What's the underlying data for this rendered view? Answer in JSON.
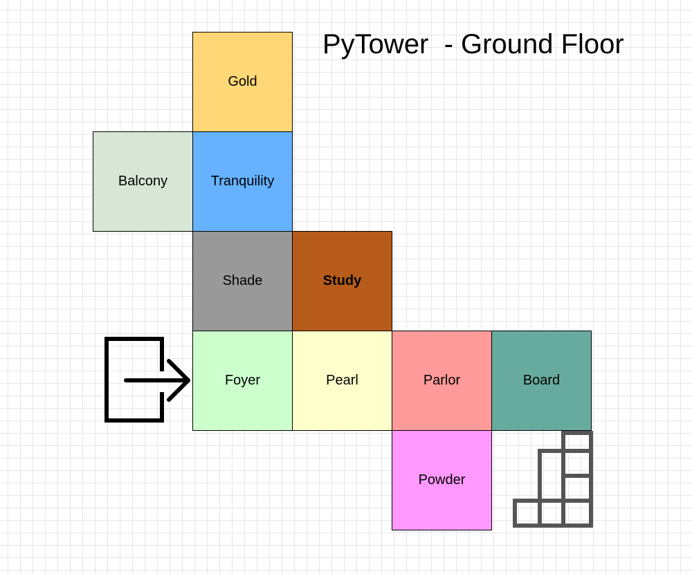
{
  "title": "PyTower  - Ground Floor",
  "rooms": {
    "gold": {
      "label": "Gold",
      "color": "#FFD776"
    },
    "balcony": {
      "label": "Balcony",
      "color": "#D7E6D5"
    },
    "tranquility": {
      "label": "Tranquility",
      "color": "#66B2FF"
    },
    "shade": {
      "label": "Shade",
      "color": "#999999"
    },
    "study": {
      "label": "Study",
      "color": "#B65B1A"
    },
    "foyer": {
      "label": "Foyer",
      "color": "#CCFFCC"
    },
    "pearl": {
      "label": "Pearl",
      "color": "#FFFFCC"
    },
    "parlor": {
      "label": "Parlor",
      "color": "#FF9A9A"
    },
    "board": {
      "label": "Board",
      "color": "#67AB9F"
    },
    "powder": {
      "label": "Powder",
      "color": "#FF99FF"
    }
  },
  "icons": {
    "entrance": "entrance-icon",
    "stairs": "stairs-icon"
  }
}
